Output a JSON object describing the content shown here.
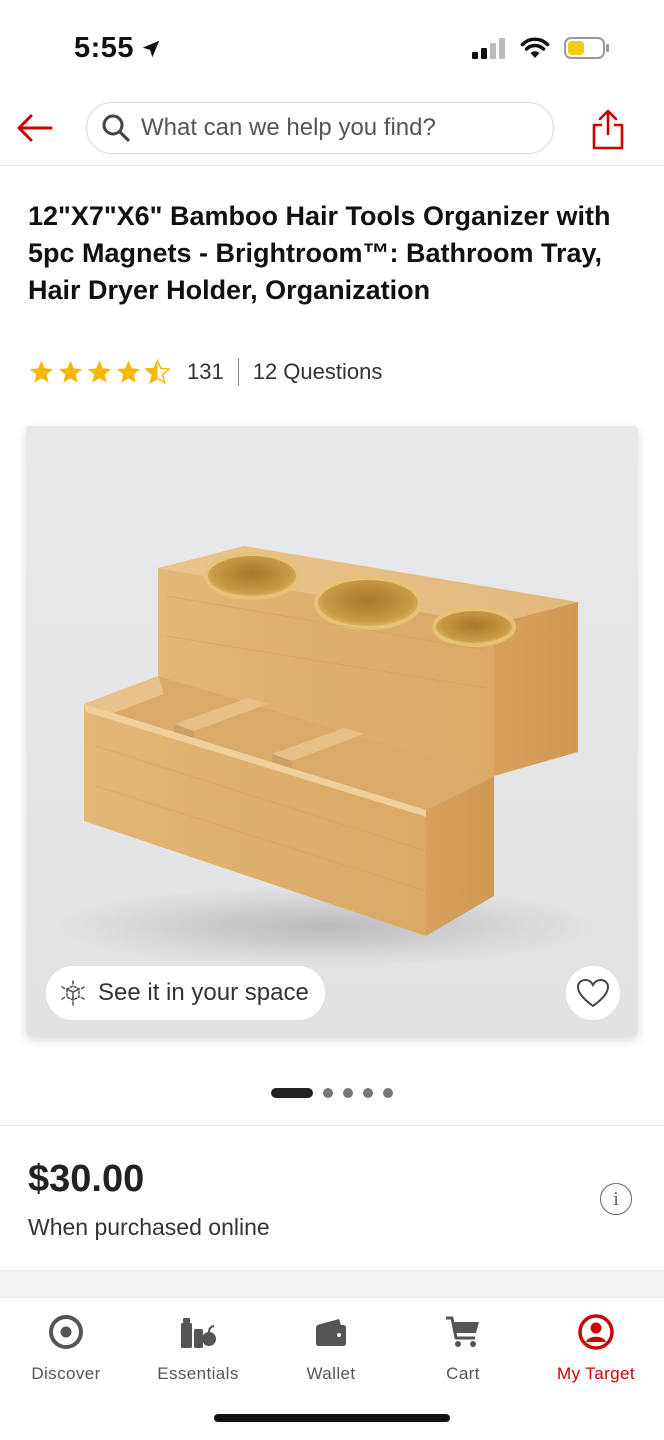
{
  "status_bar": {
    "time": "5:55",
    "icons": [
      "location-arrow-icon",
      "cellular-signal-icon",
      "wifi-icon",
      "battery-icon"
    ]
  },
  "header": {
    "back_icon": "arrow-left-icon",
    "search": {
      "placeholder": "What can we help you find?",
      "value": "",
      "icon": "search-icon"
    },
    "share_icon": "share-icon"
  },
  "product": {
    "title": "12\"X7\"X6\" Bamboo Hair Tools Organizer with 5pc Magnets - Brightroom™: Bathroom Tray, Hair Dryer Holder, Organization",
    "rating": 4.5,
    "rating_max": 5,
    "review_count": "131",
    "questions": "12 Questions",
    "see_in_space_label": "See it in your space",
    "favorite_icon": "heart-icon",
    "image_count": 5,
    "current_image": 1,
    "price": "$30.00",
    "price_note": "When purchased online",
    "info_icon": "info-icon"
  },
  "bottom_nav": {
    "items": [
      {
        "label": "Discover",
        "icon": "target-icon",
        "active": false
      },
      {
        "label": "Essentials",
        "icon": "essentials-icon",
        "active": false
      },
      {
        "label": "Wallet",
        "icon": "wallet-icon",
        "active": false
      },
      {
        "label": "Cart",
        "icon": "cart-icon",
        "active": false
      },
      {
        "label": "My Target",
        "icon": "user-circle-icon",
        "active": true
      }
    ]
  },
  "colors": {
    "brand_red": "#cc0000",
    "star_gold": "#f5b800",
    "text_dark": "#222222"
  }
}
